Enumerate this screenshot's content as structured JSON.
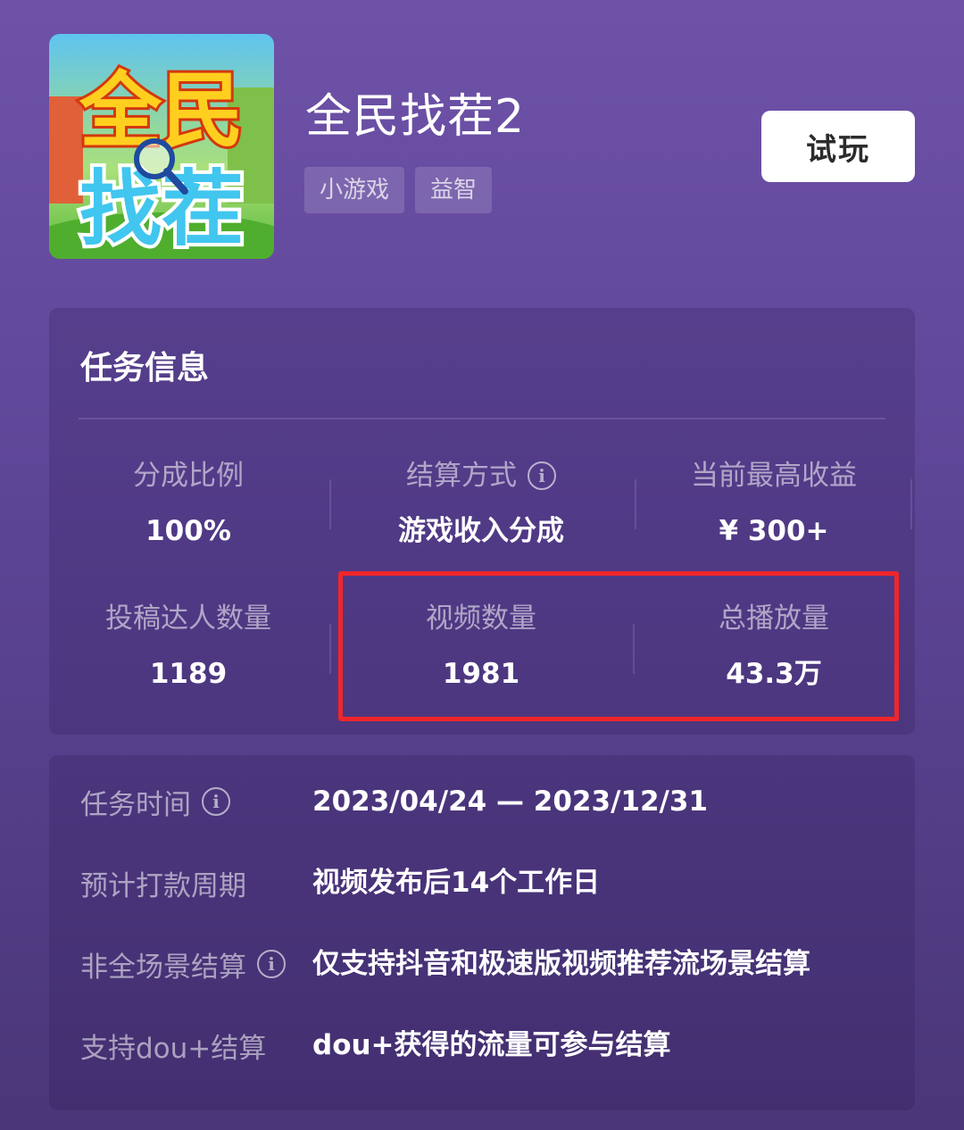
{
  "header": {
    "icon_name": "game-icon",
    "icon_text_line1": "全民",
    "icon_text_line2": "找茬",
    "title": "全民找茬2",
    "tags": [
      "小游戏",
      "益智"
    ],
    "try_label": "试玩"
  },
  "task_info": {
    "title": "任务信息",
    "stats": [
      {
        "label": "分成比例",
        "value": "100%"
      },
      {
        "label": "结算方式",
        "value": "游戏收入分成",
        "has_info": true
      },
      {
        "label": "当前最高收益",
        "value": "¥ 300+"
      },
      {
        "label": "投稿达人数量",
        "value": "1189"
      },
      {
        "label": "视频数量",
        "value": "1981"
      },
      {
        "label": "总播放量",
        "value": "43.3万"
      }
    ],
    "highlight_color": "#f0262a"
  },
  "details": [
    {
      "label": "任务时间",
      "value": "2023/04/24 — 2023/12/31",
      "has_info": true
    },
    {
      "label": "预计打款周期",
      "value": "视频发布后14个工作日"
    },
    {
      "label": "非全场景结算",
      "value": "仅支持抖音和极速版视频推荐流场景结算",
      "has_info": true
    },
    {
      "label": "支持dou+结算",
      "value": "dou+获得的流量可参与结算"
    }
  ],
  "info_glyph": "i"
}
